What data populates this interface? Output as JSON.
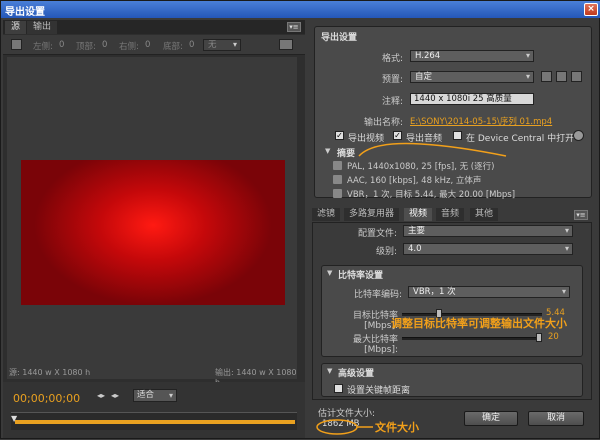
{
  "window": {
    "title": "导出设置",
    "close": "×"
  },
  "left": {
    "tabs": [
      "源",
      "输出"
    ],
    "crop": {
      "left_lbl": "左侧:",
      "left_val": "0",
      "top_lbl": "顶部:",
      "top_val": "0",
      "right_lbl": "右侧:",
      "right_val": "0",
      "bottom_lbl": "底部:",
      "bottom_val": "0",
      "ratio": "无"
    },
    "source_info": "源: 1440 w X 1080 h",
    "output_info": "输出: 1440 w X 1080 h",
    "timecode": "00;00;00;00",
    "fit": "适合"
  },
  "export": {
    "title": "导出设置",
    "format_lbl": "格式:",
    "format_val": "H.264",
    "preset_lbl": "预置:",
    "preset_val": "自定",
    "comment_lbl": "注释:",
    "comment_val": "1440 x 1080i 25 高质量",
    "output_name_lbl": "输出名称:",
    "output_name_val": "E:\\SONY\\2014-05-15\\序列 01.mp4",
    "export_video": "导出视频",
    "export_audio": "导出音频",
    "device_central": "在 Device Central 中打开",
    "summary_title": "摘要",
    "summary": [
      "PAL, 1440x1080, 25 [fps], 无 (逐行)",
      "AAC, 160 [kbps], 48 kHz, 立体声",
      "VBR，1 次, 目标 5.44, 最大 20.00 [Mbps]"
    ]
  },
  "tabs2": [
    "滤镜",
    "多路复用器",
    "视频",
    "音频",
    "其他"
  ],
  "video": {
    "profile_lbl": "配置文件:",
    "profile_val": "主要",
    "level_lbl": "级别:",
    "level_val": "4.0",
    "bitrate_title": "比特率设置",
    "encoding_lbl": "比特率编码:",
    "encoding_val": "VBR，1 次",
    "target_lbl": "目标比特率 [Mbps]:",
    "target_val": "5.44",
    "max_lbl": "最大比特率 [Mbps]:",
    "max_val": "20",
    "advanced_title": "高级设置",
    "keyframe_lbl": "设置关键帧距离"
  },
  "footer": {
    "est_lbl": "估计文件大小:",
    "est_val": "1862 MB",
    "ok": "确定",
    "cancel": "取消"
  },
  "annotations": {
    "bitrate_note": "调整目标比特率可调整输出文件大小",
    "size_note": "文件大小"
  }
}
